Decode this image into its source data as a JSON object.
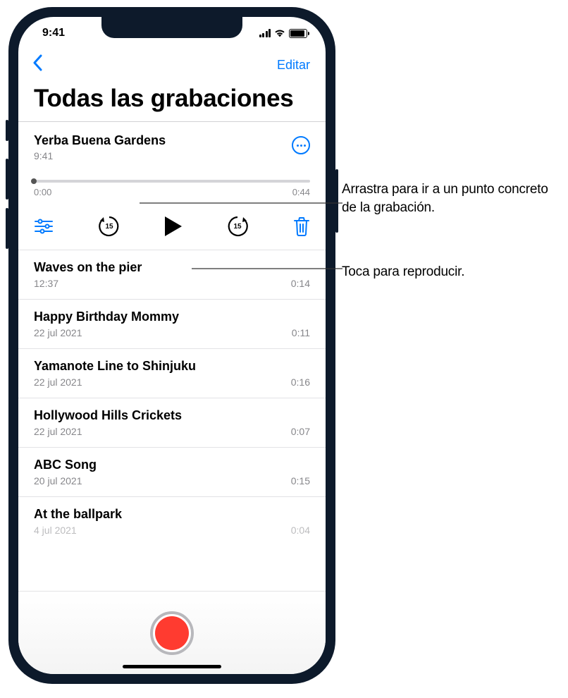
{
  "colors": {
    "accent": "#007aff",
    "record": "#ff3b30",
    "muted": "#86868a",
    "divider": "#e2e2e5"
  },
  "status": {
    "time": "9:41"
  },
  "nav": {
    "edit_label": "Editar"
  },
  "page_title": "Todas las grabaciones",
  "icons": {
    "sliders": "sliders-icon",
    "play": "play-icon",
    "skip_back": "skip-back-15-icon",
    "skip_fwd": "skip-forward-15-icon",
    "trash": "trash-icon",
    "more": "more-icon",
    "back": "back-icon"
  },
  "selected": {
    "title": "Yerba Buena Gardens",
    "subtitle": "9:41",
    "start": "0:00",
    "end": "0:44",
    "skip_amount": "15"
  },
  "recordings": [
    {
      "title": "Waves on the pier",
      "date": "12:37",
      "duration": "0:14"
    },
    {
      "title": "Happy Birthday Mommy",
      "date": "22 jul 2021",
      "duration": "0:11"
    },
    {
      "title": "Yamanote Line to Shinjuku",
      "date": "22 jul 2021",
      "duration": "0:16"
    },
    {
      "title": "Hollywood Hills Crickets",
      "date": "22 jul 2021",
      "duration": "0:07"
    },
    {
      "title": "ABC Song",
      "date": "20 jul 2021",
      "duration": "0:15"
    },
    {
      "title": "At the ballpark",
      "date": "4 jul 2021",
      "duration": "0:04"
    }
  ],
  "callouts": {
    "scrubber": "Arrastra para ir a un punto concreto de la grabación.",
    "play": "Toca para reproducir."
  }
}
